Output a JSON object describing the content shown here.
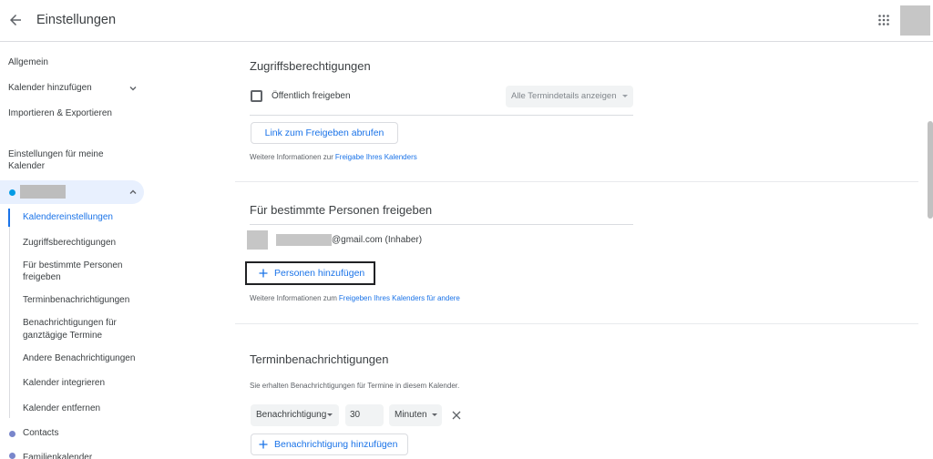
{
  "header": {
    "title": "Einstellungen"
  },
  "icons": [
    "arrow-back-icon",
    "apps-grid-icon",
    "chevron-down-icon",
    "chevron-up-icon",
    "arrow-drop-down-icon",
    "plus-icon",
    "close-icon"
  ],
  "sidebar": {
    "general": "Allgemein",
    "add_calendar": "Kalender hinzufügen",
    "import_export": "Importieren & Exportieren",
    "my_calendars_title": "Einstellungen für meine Kalender",
    "my_calendar": {
      "color": "#039be5",
      "expanded": true,
      "subitems": [
        {
          "label": "Kalendereinstellungen",
          "active": true
        },
        {
          "label": "Zugriffsberechtigungen"
        },
        {
          "label": "Für bestimmte Personen freigeben"
        },
        {
          "label": "Terminbenachrichtigungen"
        },
        {
          "label": "Benachrichtigungen für ganztägige Termine"
        },
        {
          "label": "Andere Benachrichtigungen"
        },
        {
          "label": "Kalender integrieren"
        },
        {
          "label": "Kalender entfernen"
        }
      ]
    },
    "other_calendars": [
      {
        "label": "Contacts",
        "color": "#7986cb"
      },
      {
        "label": "Familienkalender",
        "color": "#7986cb"
      }
    ]
  },
  "access": {
    "heading": "Zugriffsberechtigungen",
    "public_label": "Öffentlich freigeben",
    "public_checked": "false",
    "details_select": "Alle Termindetails anzeigen",
    "link_button": "Link zum Freigeben abrufen",
    "info_prefix": "Weitere Informationen zur",
    "info_link": "Freigabe Ihres Kalenders"
  },
  "share": {
    "heading": "Für bestimmte Personen freigeben",
    "owner_email_suffix": "@gmail.com (Inhaber)",
    "add_button": "Personen hinzufügen",
    "info_prefix": "Weitere Informationen zum",
    "info_link": "Freigeben Ihres Kalenders für andere"
  },
  "notifications": {
    "heading": "Terminbenachrichtigungen",
    "description": "Sie erhalten Benachrichtigungen für Termine in diesem Kalender.",
    "type_select": "Benachrichtigung",
    "amount": "30",
    "unit_select": "Minuten",
    "add_button": "Benachrichtigung hinzufügen"
  },
  "colors": {
    "accent": "#1a73e8",
    "text": "#3c4043",
    "muted": "#5f6368",
    "field_bg": "#f1f3f4",
    "divider": "#dadce0",
    "active_bg": "#e8f0fe"
  }
}
